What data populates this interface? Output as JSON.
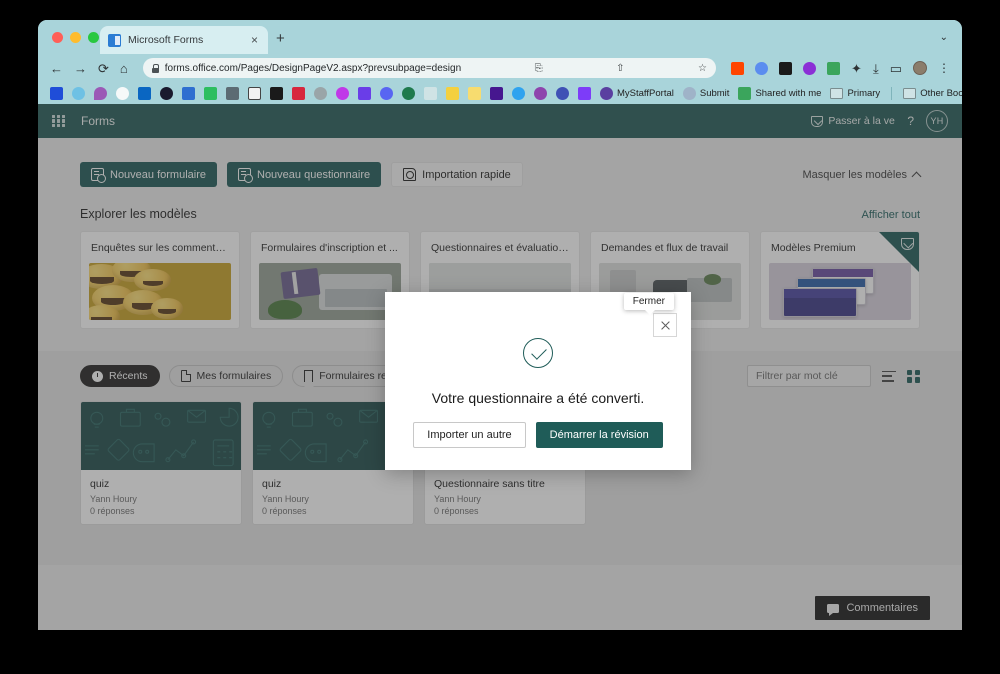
{
  "browser": {
    "tab": {
      "title": "Microsoft Forms",
      "favicon": "microsoft-forms-icon",
      "close_label": "×"
    },
    "new_tab_label": "+",
    "window_caret": "⌄",
    "nav": {
      "back": "←",
      "forward": "→",
      "reload": "⟳",
      "home": "⌂"
    },
    "omnibox": {
      "url": "forms.office.com/Pages/DesignPageV2.aspx?prevsubpage=design",
      "lock_icon": "lock-icon",
      "translate_icon": "translate-icon",
      "share_icon": "share-icon",
      "bookmark_icon": "star-icon"
    },
    "toolbar_icons": [
      {
        "name": "extension-reddit-icon",
        "color": "#ff4500"
      },
      {
        "name": "extension-blue-dot-icon",
        "color": "#5b8def"
      },
      {
        "name": "extension-settings-icon",
        "color": "#1a1a1a"
      },
      {
        "name": "extension-kami-icon",
        "color": "#8b2fd6"
      },
      {
        "name": "google-drive-icon",
        "color": "#3ba55c"
      },
      {
        "name": "extensions-puzzle-icon",
        "color": "#3c4043"
      },
      {
        "name": "downloads-icon",
        "color": "#3c4043"
      },
      {
        "name": "side-panel-icon",
        "color": "#3c4043"
      },
      {
        "name": "profile-avatar-icon",
        "color": "#8b7d6b"
      },
      {
        "name": "chrome-menu-icon",
        "color": "#3c4043"
      }
    ],
    "bookmarks": [
      {
        "label": "",
        "icon": "infinity-icon",
        "color": "#1f4dd8"
      },
      {
        "label": "",
        "icon": "cloud-icon",
        "color": "#6ec1e4"
      },
      {
        "label": "",
        "icon": "droplet-icon",
        "color": "#9b59b6"
      },
      {
        "label": "",
        "icon": "github-icon",
        "color": "#ffffff"
      },
      {
        "label": "",
        "icon": "linkedin-icon",
        "color": "#0a66c2"
      },
      {
        "label": "",
        "icon": "pocket-icon",
        "color": "#1a1a2e"
      },
      {
        "label": "",
        "icon": "docs-icon",
        "color": "#2f6fd0"
      },
      {
        "label": "",
        "icon": "evernote-icon",
        "color": "#2dbe60"
      },
      {
        "label": "",
        "icon": "archive-icon",
        "color": "#5c6b73"
      },
      {
        "label": "",
        "icon": "letterboxd-r-icon",
        "color": "#f2f2f2"
      },
      {
        "label": "",
        "icon": "readwise-icon",
        "color": "#1a1a1a"
      },
      {
        "label": "",
        "icon": "barcode-icon",
        "color": "#d7263d"
      },
      {
        "label": "",
        "icon": "gear-gray-icon",
        "color": "#9aa5a8"
      },
      {
        "label": "",
        "icon": "mastodon-icon",
        "color": "#c039e8"
      },
      {
        "label": "",
        "icon": "medium-icon",
        "color": "#6a3de8"
      },
      {
        "label": "",
        "icon": "discord-icon",
        "color": "#5865f2"
      },
      {
        "label": "",
        "icon": "notion-icon",
        "color": "#1f7a4d"
      },
      {
        "label": "",
        "icon": "x-twitter-icon",
        "color": "#e8e8e8"
      },
      {
        "label": "",
        "icon": "yellow-c-icon",
        "color": "#f4d03f"
      },
      {
        "label": "",
        "icon": "yellow-note-icon",
        "color": "#f7dc6f"
      },
      {
        "label": "",
        "icon": "kahoot-icon",
        "color": "#46178f"
      },
      {
        "label": "",
        "icon": "flipgrid-icon",
        "color": "#2fa3ef"
      },
      {
        "label": "",
        "icon": "purple-m-icon",
        "color": "#8e44ad"
      },
      {
        "label": "",
        "icon": "circle-c-icon",
        "color": "#3f51b5"
      },
      {
        "label": "",
        "icon": "camera-icon",
        "color": "#7d3cf8"
      },
      {
        "label": "MyStaffPortal",
        "icon": "w-icon",
        "color": "#5a3fa0"
      },
      {
        "label": "Submit",
        "icon": "snowflake-icon",
        "color": "#9fb3c8"
      },
      {
        "label": "Shared with me",
        "icon": "google-drive-icon",
        "color": "#3ba55c"
      },
      {
        "label": "Primary",
        "icon": "folder-icon",
        "color": "#cfe3e5"
      },
      {
        "label": "Other Bookmarks",
        "icon": "folder-icon",
        "color": "#cfe3e5"
      }
    ]
  },
  "app": {
    "topbar": {
      "waffle_icon": "app-launcher-icon",
      "brand": "Forms",
      "premium_label": "Passer à la ver",
      "premium_icon": "gem-icon",
      "help_label": "?",
      "avatar_initials": "YH"
    },
    "toolbar": {
      "new_form_label": "Nouveau formulaire",
      "new_quiz_label": "Nouveau questionnaire",
      "quick_import_label": "Importation rapide",
      "collapse_templates_label": "Masquer les modèles",
      "collapse_icon": "chevron-up-icon"
    },
    "templates_section": {
      "title": "Explorer les modèles",
      "view_all_label": "Afficher tout",
      "cards": [
        {
          "title": "Enquêtes sur les commentair...",
          "art": "emoji",
          "premium": false
        },
        {
          "title": "Formulaires d'inscription et ...",
          "art": "desk",
          "premium": false
        },
        {
          "title": "Questionnaires et évaluations",
          "art": "class",
          "premium": false
        },
        {
          "title": "Demandes et flux de travail",
          "art": "office",
          "premium": false
        },
        {
          "title": "Modèles Premium",
          "art": "prem",
          "premium": true
        }
      ]
    },
    "recents_section": {
      "filters": [
        {
          "label": "Récents",
          "icon": "clock-icon",
          "active": true
        },
        {
          "label": "Mes formulaires",
          "icon": "document-icon",
          "active": false
        },
        {
          "label": "Formulaires rem",
          "icon": "bookmark-icon",
          "active": false
        }
      ],
      "keyword_placeholder": "Filtrer par mot clé",
      "keyword_value": "",
      "list_view_icon": "list-view-icon",
      "grid_view_icon": "grid-view-icon",
      "forms": [
        {
          "name": "quiz",
          "owner": "Yann Houry",
          "responses": "0 réponses"
        },
        {
          "name": "quiz",
          "owner": "Yann Houry",
          "responses": "0 réponses"
        },
        {
          "name": "Questionnaire sans titre",
          "owner": "Yann Houry",
          "responses": "0 réponses"
        }
      ]
    },
    "feedback": {
      "label": "Commentaires",
      "icon": "chat-icon"
    },
    "modal": {
      "success_icon": "check-circle-icon",
      "message": "Votre questionnaire a été converti.",
      "secondary_button": "Importer un autre",
      "primary_button": "Démarrer la révision",
      "close_icon": "close-icon",
      "close_tooltip": "Fermer"
    }
  },
  "colors": {
    "brand_teal": "#255c59",
    "accent_teal": "#1f5c58",
    "browser_chrome": "#a9d4da",
    "app_background": "#ededed",
    "recents_band": "#e3e3e3"
  }
}
